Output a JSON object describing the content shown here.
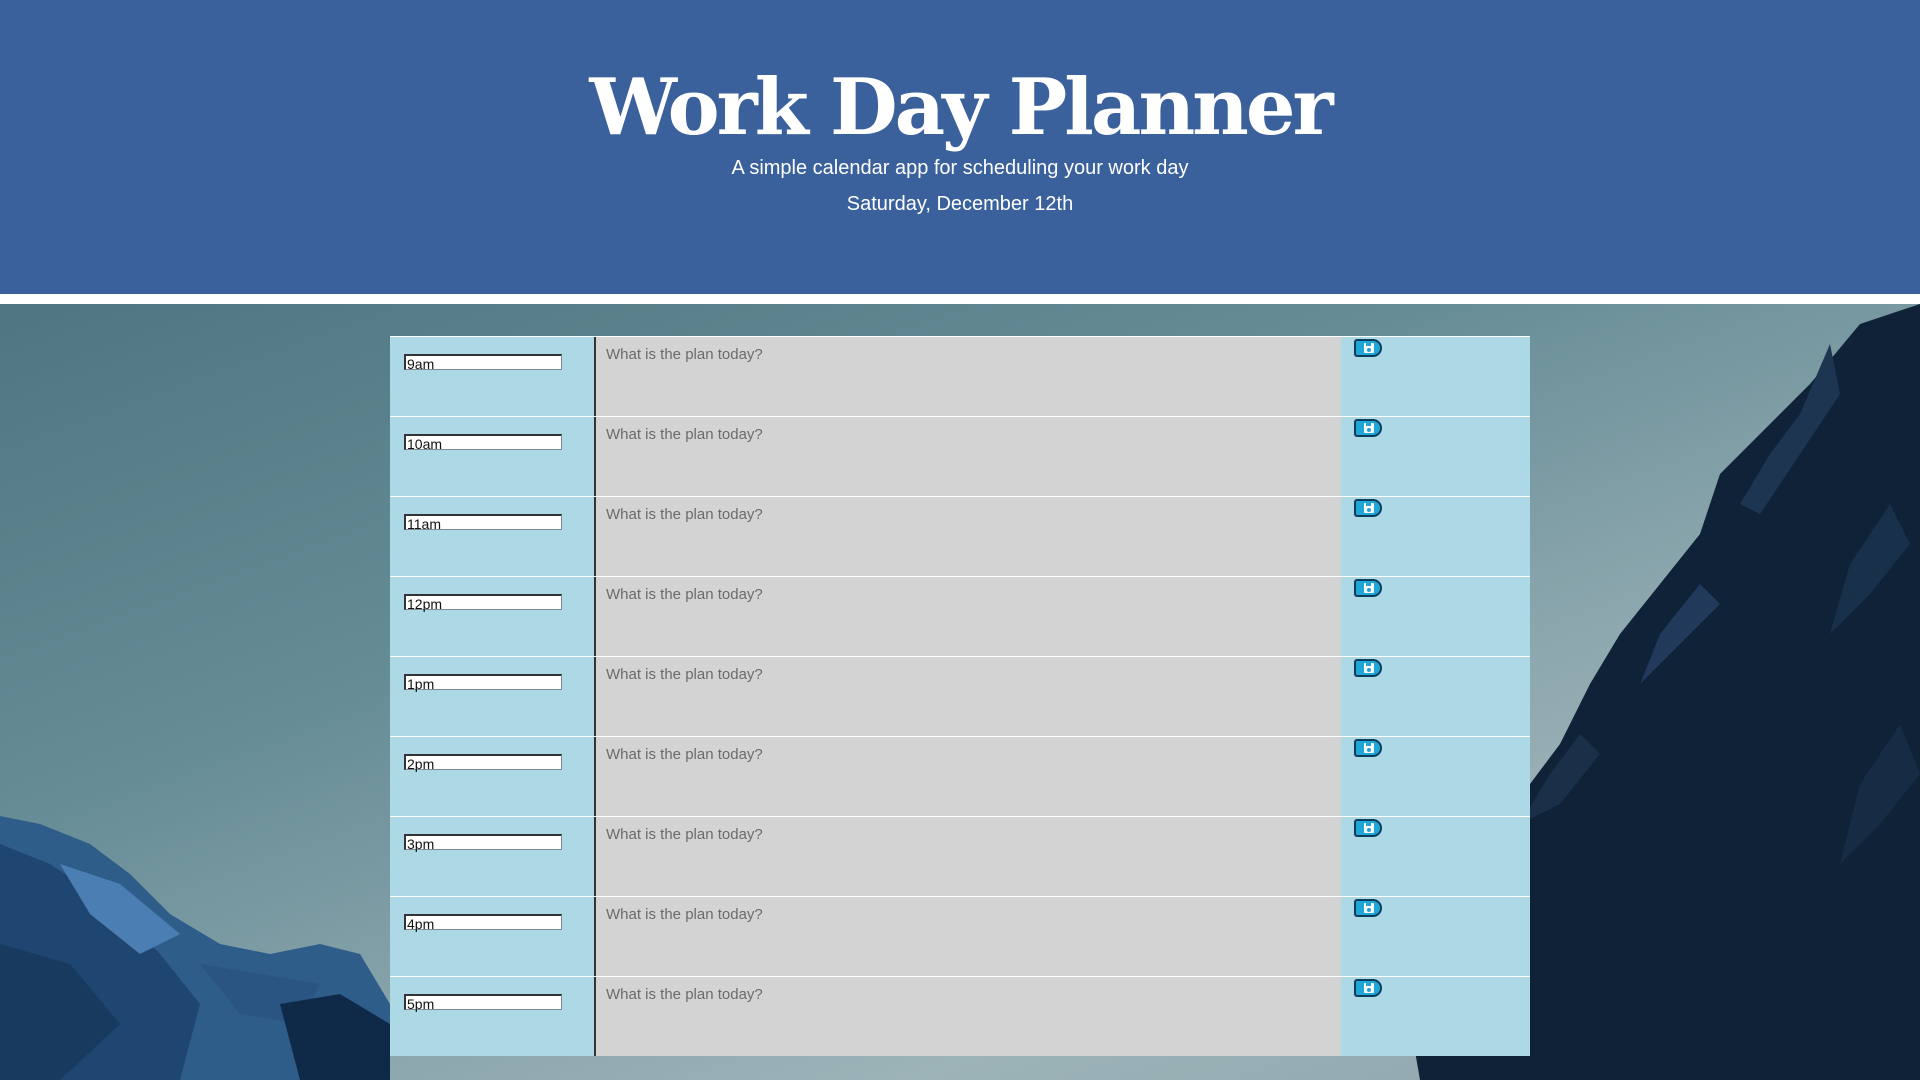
{
  "header": {
    "title": "Work Day Planner",
    "subtitle": "A simple calendar app for scheduling your work day",
    "current_day": "Saturday, December 12th"
  },
  "planner": {
    "placeholder": "What is the plan today?",
    "hours": [
      "9am",
      "10am",
      "11am",
      "12pm",
      "1pm",
      "2pm",
      "3pm",
      "4pm",
      "5pm"
    ],
    "save_icon": "floppy-disk-icon"
  },
  "colors": {
    "header_bg": "#3a619c",
    "hour_bg": "#add8e6",
    "plan_bg": "#d3d3d3",
    "save_button": "#1ea7d6"
  }
}
